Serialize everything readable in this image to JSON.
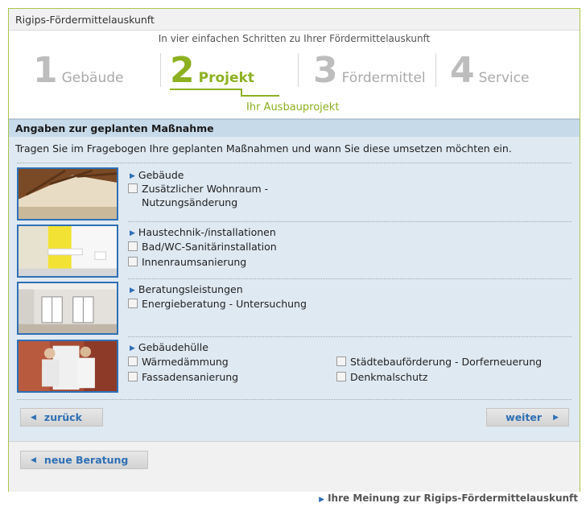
{
  "app": {
    "title": "Rigips-Fördermittelauskunft"
  },
  "wizard": {
    "subtitle": "In vier einfachen Schritten zu Ihrer Fördermittelauskunft",
    "steps": [
      {
        "num": "1",
        "label": "Gebäude"
      },
      {
        "num": "2",
        "label": "Projekt"
      },
      {
        "num": "3",
        "label": "Fördermittel"
      },
      {
        "num": "4",
        "label": "Service"
      }
    ],
    "active_step": 2,
    "active_label": "Ihr Ausbauprojekt"
  },
  "section": {
    "title": "Angaben zur geplanten Maßnahme",
    "intro": "Tragen Sie im Fragebogen Ihre geplanten Maßnahmen und wann Sie diese umsetzen möchten ein."
  },
  "categories": [
    {
      "title": "Gebäude",
      "image": "attic-room-photo",
      "options": [
        {
          "line1": "Zusätzlicher Wohnraum -",
          "line2": "Nutzungsänderung",
          "checked": false
        }
      ]
    },
    {
      "title": "Haustechnik-/installationen",
      "image": "bathroom-photo",
      "options": [
        {
          "label": "Bad/WC-Sanitärinstallation",
          "checked": false
        },
        {
          "label": "Innenraumsanierung",
          "checked": false
        }
      ]
    },
    {
      "title": "Beratungsleistungen",
      "image": "empty-room-photo",
      "options": [
        {
          "label": "Energieberatung - Untersuchung",
          "checked": false
        }
      ]
    },
    {
      "title": "Gebäudehülle",
      "image": "facade-workers-photo",
      "options": [
        {
          "label": "Wärmedämmung",
          "checked": false
        },
        {
          "label": "Fassadensanierung",
          "checked": false
        },
        {
          "label": "Städtebauförderung - Dorferneuerung",
          "checked": false
        },
        {
          "label": "Denkmalschutz",
          "checked": false
        }
      ]
    }
  ],
  "nav": {
    "back_label": "zurück",
    "next_label": "weiter",
    "new_label": "neue Beratung"
  },
  "footer": {
    "feedback_label": "Ihre Meinung zur Rigips-Fördermittelauskunft"
  },
  "colors": {
    "accent_green": "#8db021",
    "link_blue": "#2f70b5",
    "section_blue": "#c7daea",
    "content_bg": "#dfe9f2"
  }
}
